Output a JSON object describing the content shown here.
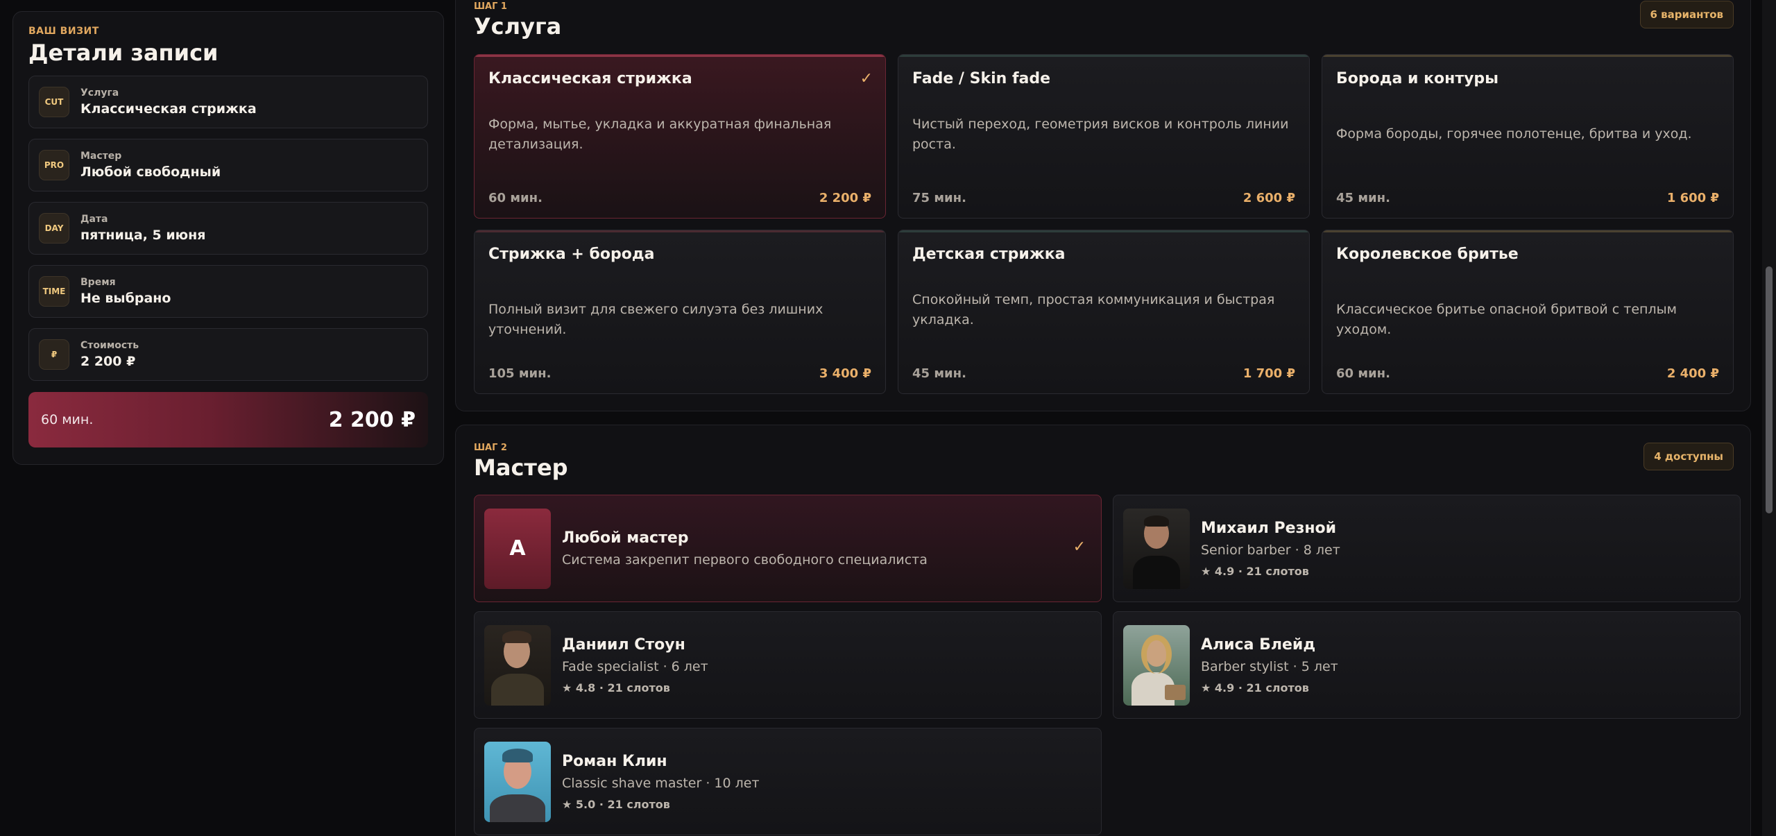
{
  "summary": {
    "kicker": "ВАШ ВИЗИТ",
    "title": "Детали записи",
    "rows": [
      {
        "icon": "CUT",
        "label": "Услуга",
        "value": "Классическая стрижка"
      },
      {
        "icon": "PRO",
        "label": "Мастер",
        "value": "Любой свободный"
      },
      {
        "icon": "DAY",
        "label": "Дата",
        "value": "пятница, 5 июня"
      },
      {
        "icon": "TIME",
        "label": "Время",
        "value": "Не выбрано"
      },
      {
        "icon": "₽",
        "label": "Стоимость",
        "value": "2 200 ₽"
      }
    ],
    "total": {
      "duration": "60 мин.",
      "price": "2 200 ₽"
    }
  },
  "step1": {
    "kicker": "ШАГ 1",
    "title": "Услуга",
    "badge": "6 вариантов",
    "services": [
      {
        "name": "Классическая стрижка",
        "desc": "Форма, мытье, укладка и аккуратная финальная детализация.",
        "duration": "60 мин.",
        "price": "2 200 ₽",
        "check": "✓"
      },
      {
        "name": "Fade / Skin fade",
        "desc": "Чистый переход, геометрия висков и контроль линии роста.",
        "duration": "75 мин.",
        "price": "2 600 ₽"
      },
      {
        "name": "Борода и контуры",
        "desc": "Форма бороды, горячее полотенце, бритва и уход.",
        "duration": "45 мин.",
        "price": "1 600 ₽"
      },
      {
        "name": "Стрижка + борода",
        "desc": "Полный визит для свежего силуэта без лишних уточнений.",
        "duration": "105 мин.",
        "price": "3 400 ₽"
      },
      {
        "name": "Детская стрижка",
        "desc": "Спокойный темп, простая коммуникация и быстрая укладка.",
        "duration": "45 мин.",
        "price": "1 700 ₽"
      },
      {
        "name": "Королевское бритье",
        "desc": "Классическое бритье опасной бритвой с теплым уходом.",
        "duration": "60 мин.",
        "price": "2 400 ₽"
      }
    ]
  },
  "step2": {
    "kicker": "ШАГ 2",
    "title": "Мастер",
    "badge": "4 доступны",
    "masters": [
      {
        "initial": "A",
        "name": "Любой мастер",
        "sub": "Система закрепит первого свободного специалиста",
        "check": "✓"
      },
      {
        "name": "Михаил Резной",
        "sub": "Senior barber · 8 лет",
        "rating": "★ 4.9 · 21 слотов"
      },
      {
        "name": "Даниил Стоун",
        "sub": "Fade specialist · 6 лет",
        "rating": "★ 4.8 · 21 слотов"
      },
      {
        "name": "Алиса Блейд",
        "sub": "Barber stylist · 5 лет",
        "rating": "★ 4.9 · 21 слотов"
      },
      {
        "name": "Роман Клин",
        "sub": "Classic shave master · 10 лет",
        "rating": "★ 5.0 · 21 слотов"
      }
    ]
  }
}
